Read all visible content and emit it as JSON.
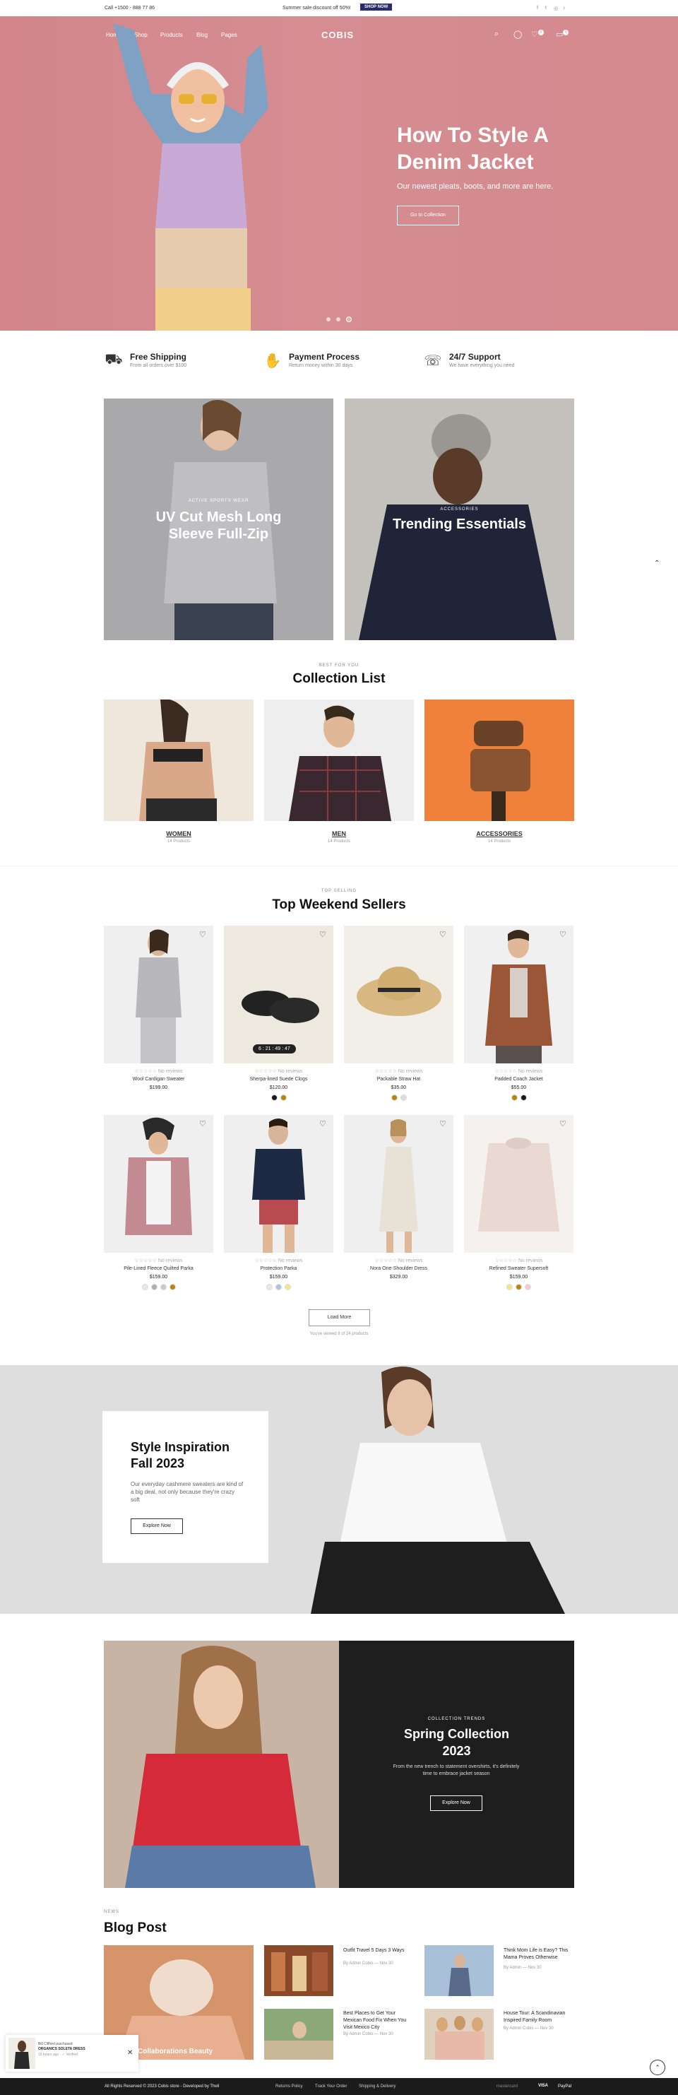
{
  "topbar": {
    "phone": "Call +1500 - 888 77 86",
    "promo": "Summer sale discount off 50%!",
    "shop_now": "SHOP NOW"
  },
  "nav": {
    "logo": "COBIS",
    "links": [
      "Home",
      "Shop",
      "Products",
      "Blog",
      "Pages"
    ],
    "wishlist_count": "0",
    "cart_count": "0"
  },
  "hero": {
    "title_line1": "How To Style A",
    "title_line2": "Denim Jacket",
    "subtitle": "Our newest pleats, boots, and more are here.",
    "button": "Go to Collection"
  },
  "features": [
    {
      "title": "Free Shipping",
      "sub": "From all orders over $100",
      "icon": "shipping-icon"
    },
    {
      "title": "Payment Process",
      "sub": "Return money within 30 days",
      "icon": "handshake-icon"
    },
    {
      "title": "24/7 Support",
      "sub": "We have everything you need",
      "icon": "support-icon"
    }
  ],
  "promos": [
    {
      "tag": "ACTIVE SPORTS WEAR",
      "title_line1": "UV Cut Mesh Long",
      "title_line2": "Sleeve Full-Zip"
    },
    {
      "tag": "ACCESSORIES",
      "title_line1": "Trending Essentials",
      "title_line2": ""
    }
  ],
  "collections": {
    "tag": "BEST FOR YOU",
    "title": "Collection List",
    "items": [
      {
        "label": "WOMEN",
        "count": "14 Products"
      },
      {
        "label": "MEN",
        "count": "14 Products"
      },
      {
        "label": "ACCESSORIES",
        "count": "14 Products"
      }
    ]
  },
  "sellers": {
    "tag": "TOP SELLING",
    "title": "Top Weekend Sellers",
    "countdown": "6 : 21 : 49 : 47",
    "products": [
      {
        "name": "Wool Cardigan Sweater",
        "price": "$199.00",
        "reviews": "No reviews",
        "swatches": []
      },
      {
        "name": "Sherpa-lined Suede Clogs",
        "price": "$120.00",
        "reviews": "No reviews",
        "swatches": [
          "#1a1a1a",
          "#b8860b"
        ]
      },
      {
        "name": "Packable Straw Hat",
        "price": "$35.00",
        "reviews": "No reviews",
        "swatches": [
          "#b8860b",
          "#dcdcdc"
        ]
      },
      {
        "name": "Padded Coach Jacket",
        "price": "$55.00",
        "reviews": "No reviews",
        "swatches": [
          "#b8860b",
          "#1a1a1a"
        ]
      },
      {
        "name": "Pile-Lined Fleece Quilted Parka",
        "price": "$159.00",
        "reviews": "No reviews",
        "swatches": [
          "#e6e6e6",
          "#b0b0b0",
          "#c9c9c9",
          "#b8860b"
        ]
      },
      {
        "name": "Protection Parka",
        "price": "$159.00",
        "reviews": "No reviews",
        "swatches": [
          "#e6e6e6",
          "#a8c4e0",
          "#f0e68c"
        ]
      },
      {
        "name": "Nora One-Shoulder Dress",
        "price": "$329.00",
        "reviews": "No reviews",
        "swatches": []
      },
      {
        "name": "Refined Sweater Supersoft",
        "price": "$159.00",
        "reviews": "No reviews",
        "swatches": [
          "#f0e68c",
          "#b8860b",
          "#f4c6d6"
        ]
      }
    ],
    "load_more": "Load More",
    "viewed_text": "You've viewed 8 of 24 products"
  },
  "style": {
    "title_line1": "Style Inspiration",
    "title_line2": "Fall 2023",
    "text": "Our everyday cashmere sweaters are kind of a big deal, not only because they're crazy soft",
    "button": "Explore Now"
  },
  "spring": {
    "tag": "COLLECTION TRENDS",
    "title_line1": "Spring Collection",
    "title_line2": "2023",
    "text": "From the new trench to statement overshirts, it's definitely time to embrace jacket season",
    "button": "Explore Now"
  },
  "blog": {
    "tag": "NEWS",
    "title": "Blog Post",
    "featured": "Collaborations Beauty",
    "posts": [
      {
        "title": "Outfit Travel 5 Days 3 Ways",
        "author": "By Admin Cobis",
        "date": "Nov 30"
      },
      {
        "title": "Think Mom Life is Easy? This Mama Proves Otherwise",
        "author": "By Admin",
        "date": "Nov 30"
      },
      {
        "title": "Best Places to Get Your Mexican Food Fix When You Visit Mexico City",
        "author": "By Admin Cobis",
        "date": "Nov 30"
      },
      {
        "title": "House Tour: A Scandinavian Inspired Family Room",
        "author": "By Admin Cobis",
        "date": "Nov 30"
      }
    ]
  },
  "toast": {
    "line1": "Bill Clifford purchased",
    "line2": "ORGANICS SOLETA DRESS",
    "time": "16 hours ago",
    "verified": "Verified"
  },
  "footer": {
    "copyright": "All Rights Reserved © 2023 Cobis store - Developed by Theli",
    "links": [
      "Returns Policy",
      "Track Your Order",
      "Shipping & Delivery"
    ],
    "payments": [
      "mastercard",
      "VISA",
      "PayPal"
    ]
  }
}
